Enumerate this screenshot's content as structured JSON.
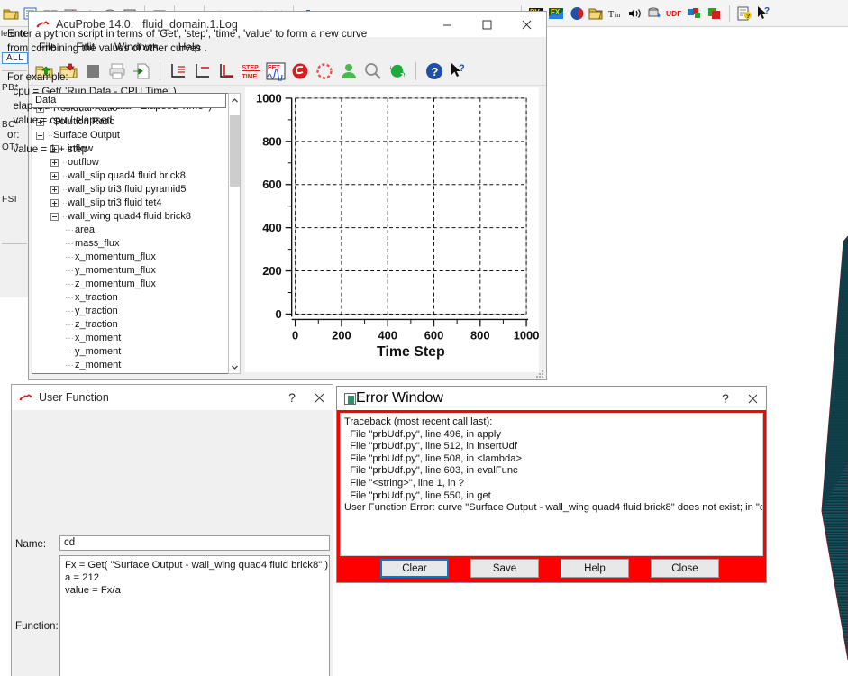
{
  "background_app": {
    "left_panel": {
      "header": "le entit",
      "items": [
        {
          "label": "ALL",
          "selected": true
        },
        {
          "label": "PB*",
          "selected": false
        },
        {
          "label": "BC*",
          "selected": false
        },
        {
          "label": "OT*",
          "selected": false
        },
        {
          "label": "FSI",
          "selected": false
        }
      ]
    },
    "toolbar_icons": [
      "open-folder-icon",
      "list-view-icon",
      "mesh-icon",
      "flag-icon",
      "node-icon",
      "surface-icon",
      "box-icon",
      "separator",
      "window-icon",
      "separator",
      "ellipsis-icon",
      "separator",
      "cloud-icon",
      "warning-icon",
      "cursor-y-icon",
      "cursor-x-icon",
      "separator",
      "pin-icon",
      "wave-icon",
      "car-icon",
      "arch-icon",
      "cone-icon",
      "rocket-icon",
      "swirl-icon",
      "plate-icon",
      "pin2-icon",
      "pins-icon",
      "dot-icon",
      "separator",
      "pv-icon",
      "fx-icon",
      "c-icon",
      "folder-open-icon",
      "tin-icon",
      "speaker-icon",
      "drop-icon",
      "udf-icon",
      "multi-icon",
      "layers-icon",
      "separator",
      "help-doc-icon",
      "help-arrow-icon"
    ],
    "udf_label": "UDF",
    "tin_label": "Tin"
  },
  "acuprobe": {
    "title_app": "AcuProbe 14.0:",
    "title_file": "fluid_domain.1.Log",
    "app_icon": "acuprobe-icon",
    "window_buttons": {
      "minimize": "—",
      "maximize": "☐",
      "close": "✕"
    },
    "menu": [
      "File",
      "Edit",
      "Windows",
      "Help"
    ],
    "toolbar_icons": [
      "open-folder-green-icon",
      "open-folder-red-icon",
      "stop-icon",
      "print-icon",
      "export-icon",
      "separator",
      "plot-lines-icon",
      "plot-single-icon",
      "plot-bar-icon",
      "step-time-icon",
      "fft-icon",
      "spiral-icon",
      "dashed-circle-icon",
      "user-icon",
      "zoom-icon",
      "refresh-icon",
      "separator",
      "help-icon",
      "help-arrow-icon"
    ],
    "toolbar_text": {
      "step": "STEP",
      "time": "TIME",
      "fft": "FFT"
    },
    "tree_header": "Data",
    "tree": [
      {
        "label": "Residual Ratio",
        "depth": 0,
        "state": "plus",
        "clipped": true
      },
      {
        "label": "Solution Ratio",
        "depth": 0,
        "state": "plus"
      },
      {
        "label": "Surface Output",
        "depth": 0,
        "state": "minus"
      },
      {
        "label": "inflow",
        "depth": 1,
        "state": "plus"
      },
      {
        "label": "outflow",
        "depth": 1,
        "state": "plus"
      },
      {
        "label": "wall_slip quad4 fluid brick8",
        "depth": 1,
        "state": "plus"
      },
      {
        "label": "wall_slip tri3 fluid pyramid5",
        "depth": 1,
        "state": "plus"
      },
      {
        "label": "wall_slip tri3 fluid tet4",
        "depth": 1,
        "state": "plus"
      },
      {
        "label": "wall_wing quad4 fluid brick8",
        "depth": 1,
        "state": "minus"
      },
      {
        "label": "area",
        "depth": 2,
        "state": "leaf"
      },
      {
        "label": "mass_flux",
        "depth": 2,
        "state": "leaf"
      },
      {
        "label": "x_momentum_flux",
        "depth": 2,
        "state": "leaf"
      },
      {
        "label": "y_momentum_flux",
        "depth": 2,
        "state": "leaf"
      },
      {
        "label": "z_momentum_flux",
        "depth": 2,
        "state": "leaf"
      },
      {
        "label": "x_traction",
        "depth": 2,
        "state": "leaf"
      },
      {
        "label": "y_traction",
        "depth": 2,
        "state": "leaf"
      },
      {
        "label": "z_traction",
        "depth": 2,
        "state": "leaf"
      },
      {
        "label": "x_moment",
        "depth": 2,
        "state": "leaf"
      },
      {
        "label": "y_moment",
        "depth": 2,
        "state": "leaf"
      },
      {
        "label": "z_moment",
        "depth": 2,
        "state": "leaf"
      }
    ],
    "scrollbar": {
      "up_arrow": "⌃",
      "down_arrow": "⌄"
    }
  },
  "chart_data": {
    "type": "line",
    "title": "",
    "xlabel": "Time Step",
    "ylabel": "",
    "x_ticks": [
      0,
      200,
      400,
      600,
      800,
      1000
    ],
    "y_ticks": [
      0,
      200,
      400,
      600,
      800,
      1000
    ],
    "xlim": [
      0,
      1000
    ],
    "ylim": [
      0,
      1000
    ],
    "grid": true,
    "grid_style": "dashed",
    "legend": null,
    "series": [],
    "note": "empty plot - no curves displayed"
  },
  "user_function": {
    "title": "User Function",
    "app_icon": "acuprobe-icon",
    "help_button": "?",
    "close_button": "✕",
    "description": "Enter a python script in terms of 'Get', 'step', 'time', 'value' to form a new curve\nfrom combining the values of other curves .\n\nFor example:\n  cpu = Get( 'Run Data - CPU Time' )\n  elapsed = Get( 'Run Data - Elapsed Time' )\n  value = cpu / elapsed\nor:\n  value = 1 + step",
    "name_label": "Name:",
    "name_value": "cd",
    "name_placeholder": "",
    "function_label": "Function:",
    "function_value": "Fx = Get( \"Surface Output - wall_wing quad4 fluid brick8\" )\na = 212\nvalue = Fx/a"
  },
  "error_window": {
    "title": "Error Window",
    "icon": "error-window-icon",
    "help_button": "?",
    "close_button": "✕",
    "accent_color": "#ff0000",
    "traceback": "Traceback (most recent call last):\n  File \"prbUdf.py\", line 496, in apply\n  File \"prbUdf.py\", line 512, in insertUdf\n  File \"prbUdf.py\", line 508, in <lambda>\n  File \"prbUdf.py\", line 603, in evalFunc\n  File \"<string>\", line 1, in ?\n  File \"prbUdf.py\", line 550, in get\nUser Function Error: curve \"Surface Output - wall_wing quad4 fluid brick8\" does not exist; in \"cd\"",
    "buttons": [
      {
        "label": "Clear",
        "focused": true
      },
      {
        "label": "Save",
        "focused": false
      },
      {
        "label": "Help",
        "focused": false
      },
      {
        "label": "Close",
        "focused": false
      }
    ]
  },
  "colors": {
    "error_red": "#ff0000",
    "focus_blue": "#0078d7",
    "wing_teal": "#14555e",
    "window_gray": "#f0f0f0"
  }
}
